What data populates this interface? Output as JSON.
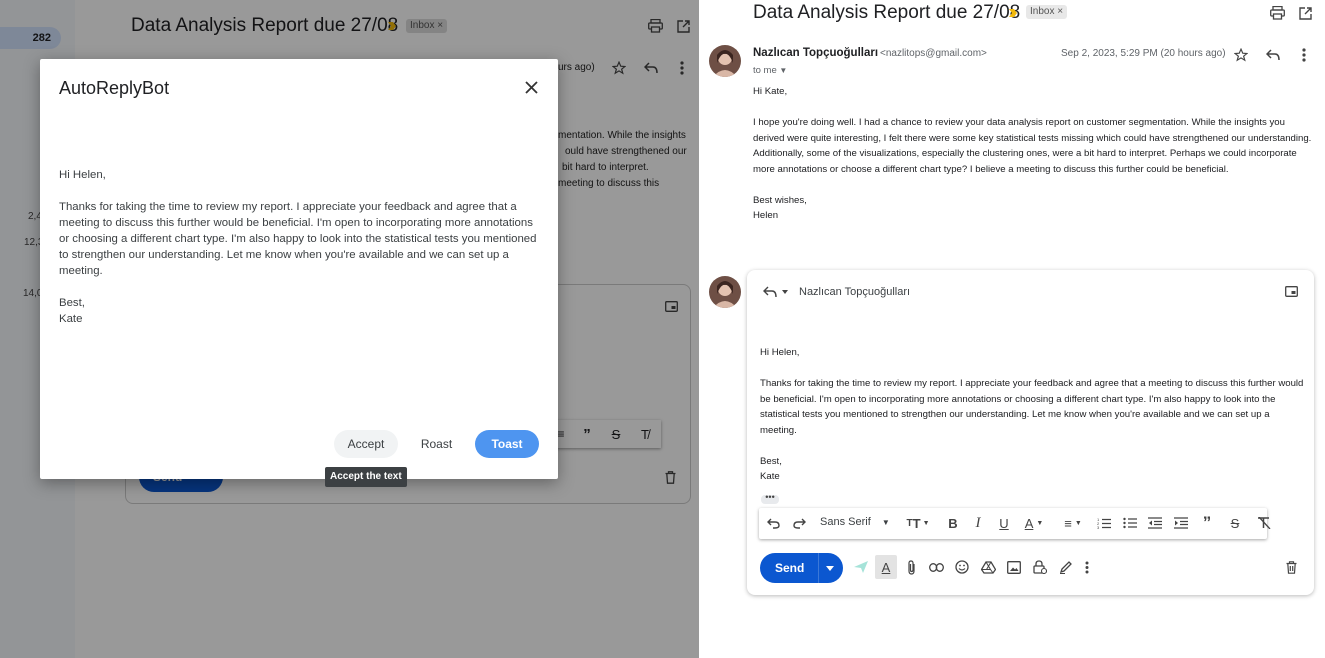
{
  "left": {
    "nav_count": "282",
    "clipped_numbers": [
      "2,4",
      "12,3",
      "14,0"
    ],
    "title": "Data Analysis Report due 27/08",
    "inbox_chip": "Inbox ×",
    "date_fragment": "urs ago)",
    "body_fragments": [
      "mentation. While the insights",
      "ould have strengthened our",
      "bit hard to interpret.",
      "meeting to discuss this"
    ],
    "send_label": "Send"
  },
  "dialog": {
    "title": "AutoReplyBot",
    "greeting": "Hi Helen,",
    "paragraph": "Thanks for taking the time to review my report. I appreciate your feedback and agree that a meeting to discuss this further would be beneficial. I'm open to incorporating more annotations or choosing a different chart type. I'm also happy to look into the statistical tests you mentioned to strengthen our understanding. Let me know when you're available and we can set up a meeting.",
    "signoff": "Best,",
    "signature": "Kate",
    "buttons": {
      "accept": "Accept",
      "roast": "Roast",
      "toast": "Toast"
    },
    "tooltip": "Accept the text"
  },
  "right": {
    "title": "Data Analysis Report due 27/08",
    "inbox_chip": "Inbox ×",
    "message": {
      "sender_name": "Nazlıcan Topçuoğulları",
      "sender_email": "<nazlitops@gmail.com>",
      "date": "Sep 2, 2023, 5:29 PM (20 hours ago)",
      "to": "to me",
      "greeting": "Hi Kate,",
      "paragraph": "I hope you're doing well. I had a chance to review your data analysis report on customer segmentation. While the insights you derived were quite interesting, I felt there were some key statistical tests missing which could have strengthened our understanding. Additionally, some of the visualizations, especially the clustering ones, were a bit hard to interpret. Perhaps we could incorporate more annotations or choose a different chart type? I believe a meeting to discuss this further could be beneficial.",
      "signoff": "Best wishes,",
      "signature": "Helen"
    },
    "compose": {
      "recipient": "Nazlıcan Topçuoğulları",
      "greeting": "Hi Helen,",
      "paragraph": "Thanks for taking the time to review my report. I appreciate your feedback and agree that a meeting to discuss this further would be beneficial. I'm open to incorporating more annotations or choosing a different chart type. I'm also happy to look into the statistical tests you mentioned to strengthen our understanding. Let me know when you're available and we can set up a meeting.",
      "signoff": "Best,",
      "signature": "Kate",
      "font": "Sans Serif",
      "send_label": "Send"
    }
  },
  "colors": {
    "primary_blue": "#0b57d0",
    "toast_blue": "#4e95f0",
    "overlay": "rgba(0,0,0,0.40)",
    "important_marker": "#f2b90c"
  }
}
